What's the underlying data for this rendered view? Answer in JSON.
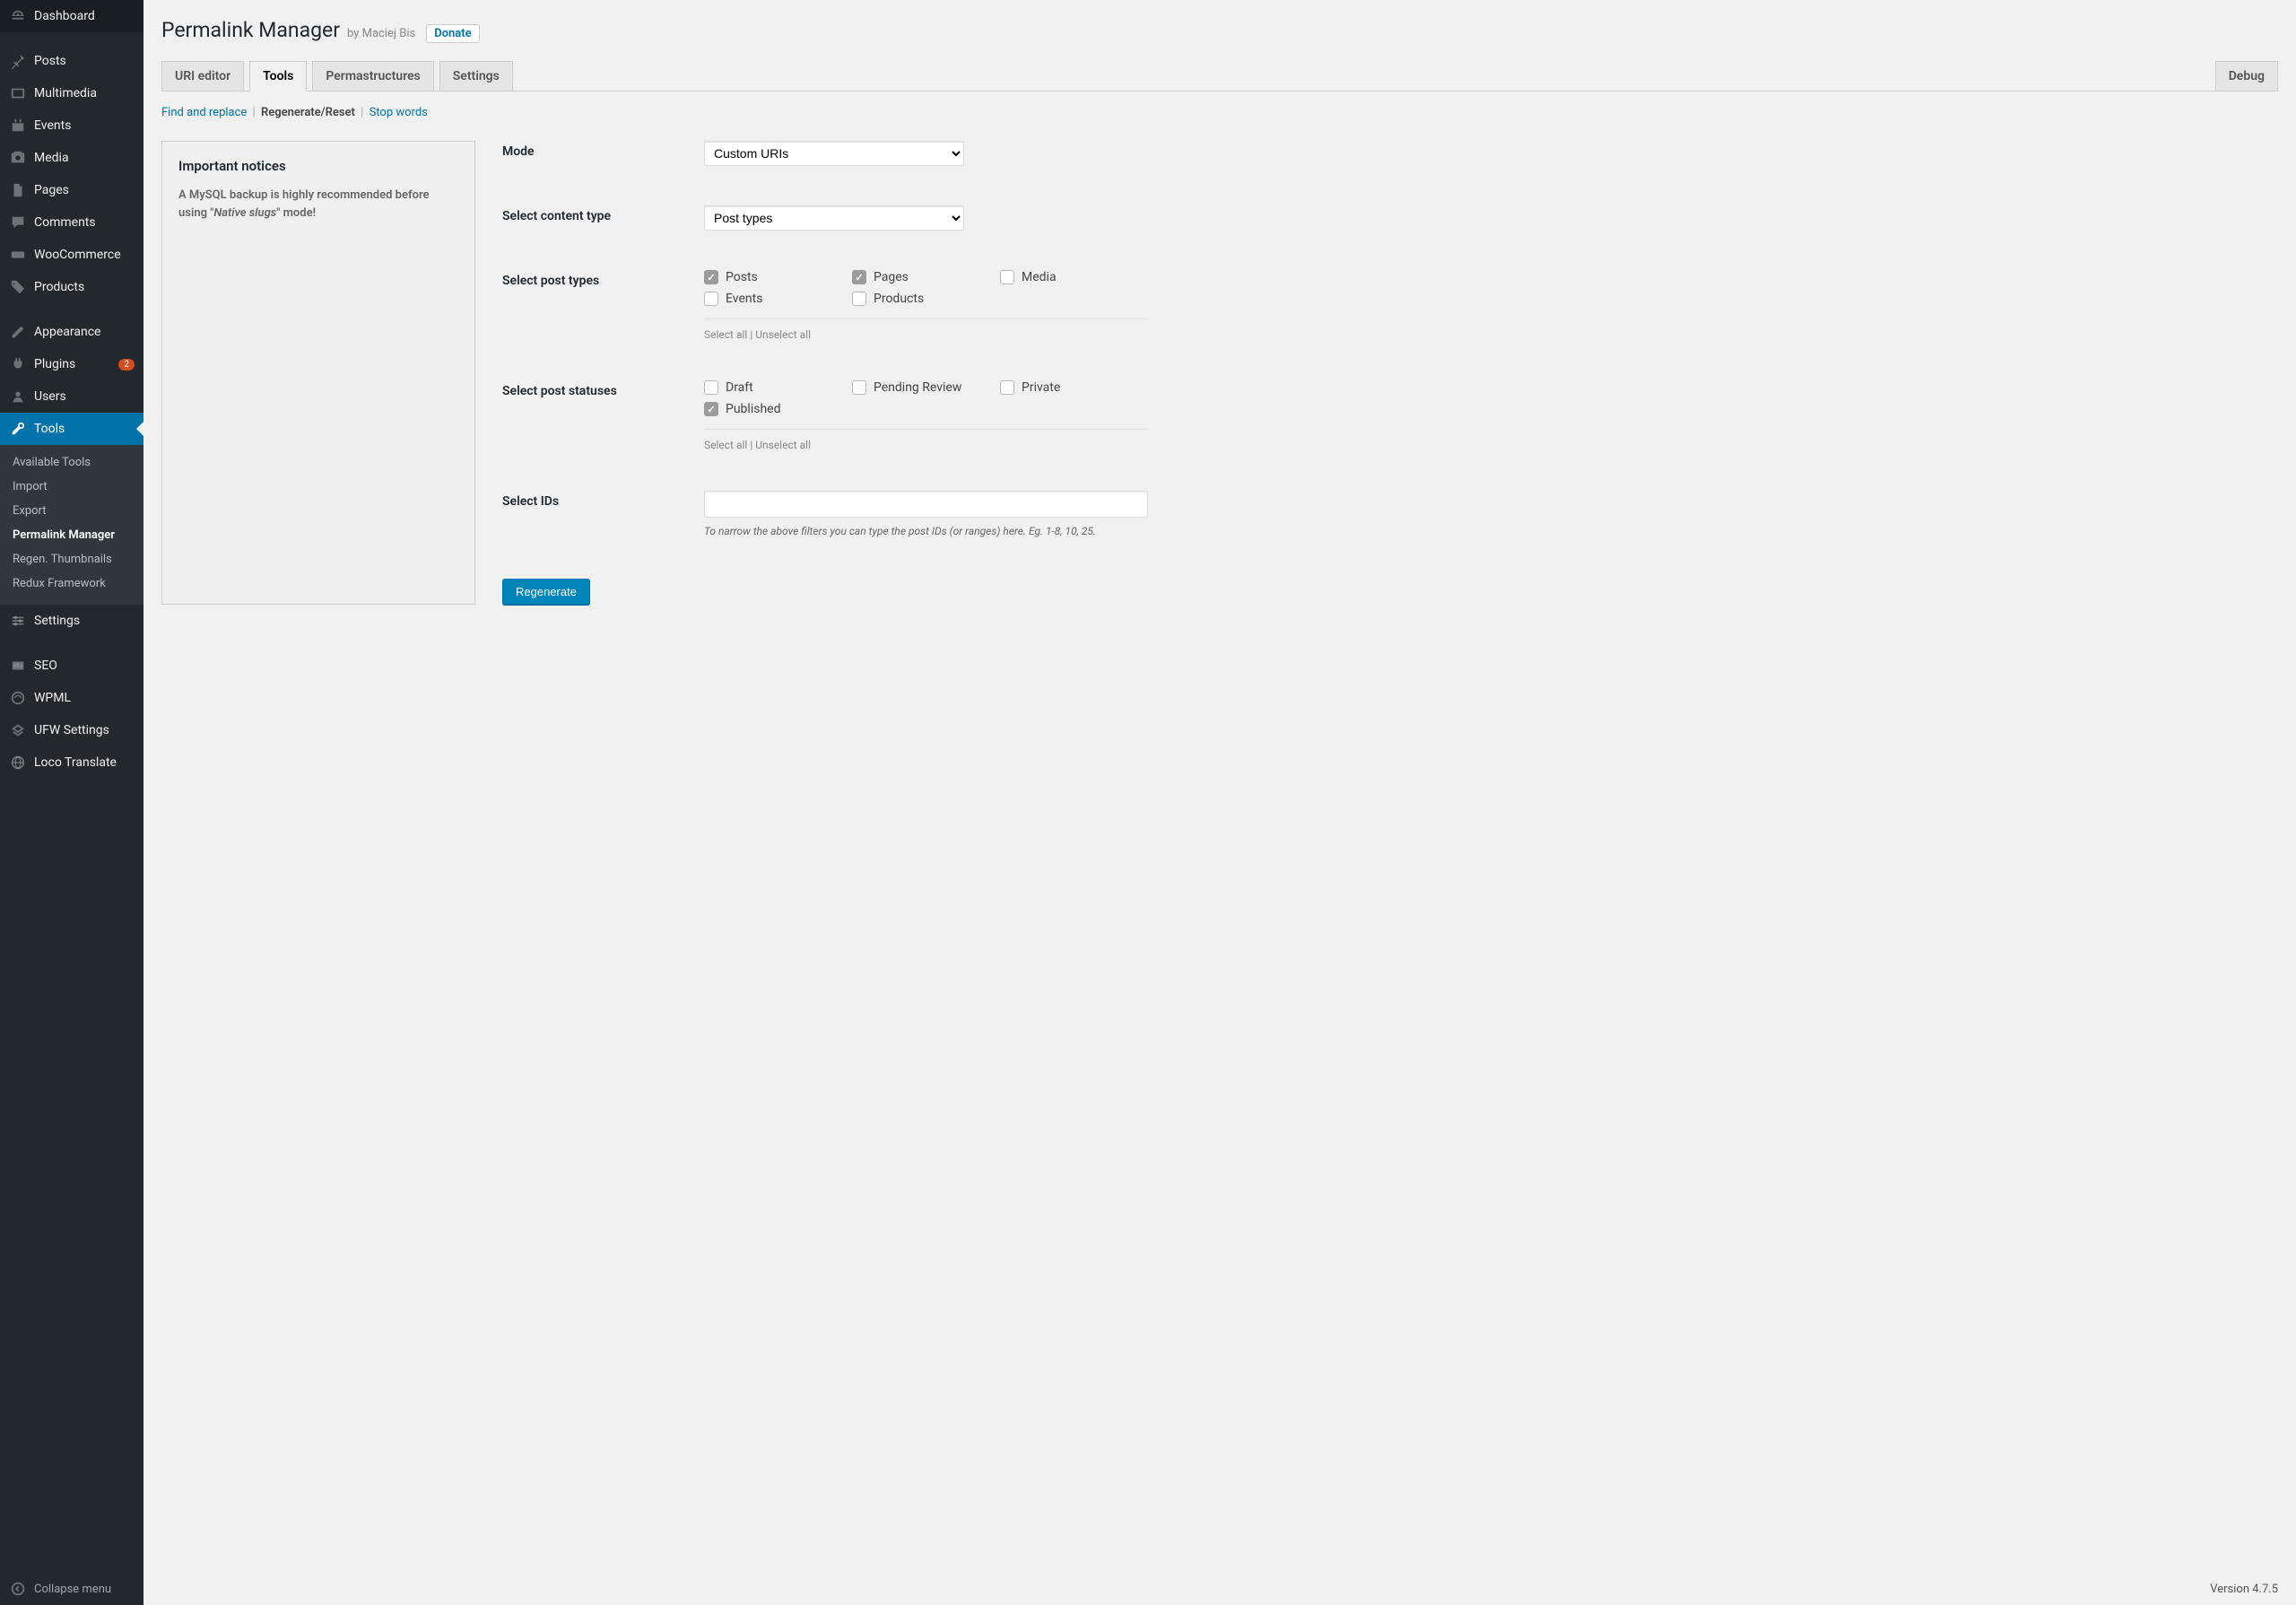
{
  "sidebar": {
    "items": [
      {
        "label": "Dashboard",
        "icon": "dashboard"
      },
      {
        "label": "Posts",
        "icon": "pin"
      },
      {
        "label": "Multimedia",
        "icon": "multimedia"
      },
      {
        "label": "Events",
        "icon": "events"
      },
      {
        "label": "Media",
        "icon": "media"
      },
      {
        "label": "Pages",
        "icon": "pages"
      },
      {
        "label": "Comments",
        "icon": "comments"
      },
      {
        "label": "WooCommerce",
        "icon": "woo"
      },
      {
        "label": "Products",
        "icon": "products"
      },
      {
        "label": "Appearance",
        "icon": "appearance"
      },
      {
        "label": "Plugins",
        "icon": "plugins",
        "badge": "2"
      },
      {
        "label": "Users",
        "icon": "users"
      },
      {
        "label": "Tools",
        "icon": "tools",
        "current": true
      },
      {
        "label": "Settings",
        "icon": "settings"
      },
      {
        "label": "SEO",
        "icon": "seo"
      },
      {
        "label": "WPML",
        "icon": "wpml"
      },
      {
        "label": "UFW Settings",
        "icon": "ufw"
      },
      {
        "label": "Loco Translate",
        "icon": "loco"
      }
    ],
    "submenu": [
      {
        "label": "Available Tools"
      },
      {
        "label": "Import"
      },
      {
        "label": "Export"
      },
      {
        "label": "Permalink Manager",
        "active": true
      },
      {
        "label": "Regen. Thumbnails"
      },
      {
        "label": "Redux Framework"
      }
    ],
    "collapse": "Collapse menu"
  },
  "header": {
    "title": "Permalink Manager",
    "byline": "by Maciej Bis",
    "donate": "Donate"
  },
  "tabs": [
    {
      "label": "URI editor"
    },
    {
      "label": "Tools",
      "active": true
    },
    {
      "label": "Permastructures"
    },
    {
      "label": "Settings"
    },
    {
      "label": "Debug",
      "right": true
    }
  ],
  "subtabs": {
    "find": "Find and replace",
    "regen": "Regenerate/Reset",
    "stop": "Stop words"
  },
  "notice": {
    "title": "Important notices",
    "text_before": "A MySQL backup is highly recommended before using \"",
    "text_em": "Native slugs",
    "text_after": "\" mode!"
  },
  "form": {
    "mode_label": "Mode",
    "mode_value": "Custom URIs",
    "content_type_label": "Select content type",
    "content_type_value": "Post types",
    "post_types_label": "Select post types",
    "post_types": [
      {
        "label": "Posts",
        "checked": true
      },
      {
        "label": "Pages",
        "checked": true
      },
      {
        "label": "Media",
        "checked": false
      },
      {
        "label": "Events",
        "checked": false
      },
      {
        "label": "Products",
        "checked": false
      }
    ],
    "post_statuses_label": "Select post statuses",
    "post_statuses": [
      {
        "label": "Draft",
        "checked": false
      },
      {
        "label": "Pending Review",
        "checked": false
      },
      {
        "label": "Private",
        "checked": false
      },
      {
        "label": "Published",
        "checked": true
      }
    ],
    "select_all": "Select all",
    "unselect_all": "Unselect all",
    "select_ids_label": "Select IDs",
    "select_ids_value": "",
    "select_ids_helper": "To narrow the above filters you can type the post IDs (or ranges) here. Eg. 1-8, 10, 25.",
    "submit": "Regenerate"
  },
  "footer": {
    "version": "Version 4.7.5"
  }
}
